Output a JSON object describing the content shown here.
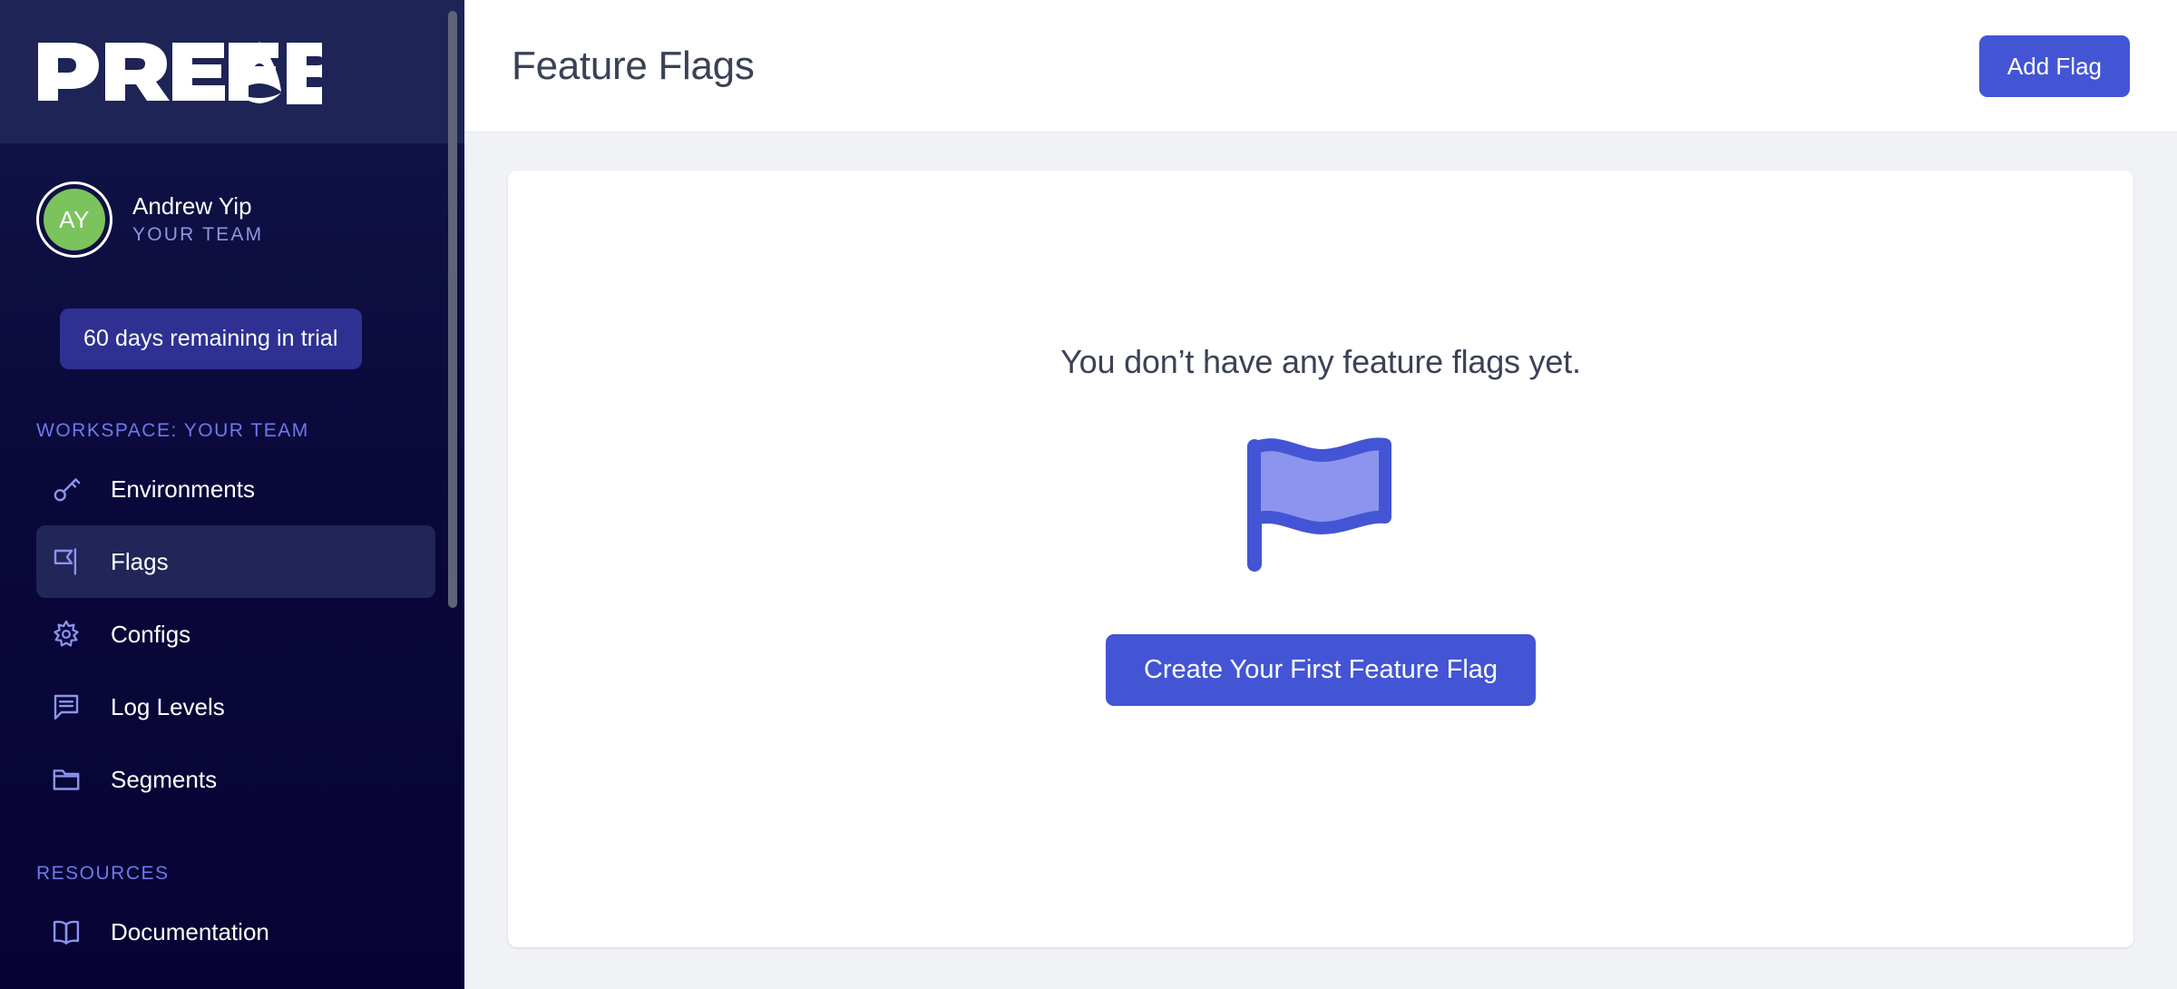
{
  "brand": {
    "name": "PREFAB",
    "logo_icon": "prefab-rocket-logo",
    "logo_color": "#ffffff",
    "sidebar_top_color": "#1e2456",
    "sidebar_bottom_color": "#070334"
  },
  "user": {
    "initials": "AY",
    "name": "Andrew Yip",
    "team": "YOUR TEAM",
    "avatar_color": "#7ac35d"
  },
  "trial": {
    "label": "60 days remaining in trial",
    "badge_color": "#2e3192"
  },
  "sidebar": {
    "sections": [
      {
        "label": "WORKSPACE: YOUR TEAM",
        "items": [
          {
            "label": "Environments",
            "icon": "key-icon",
            "active": false
          },
          {
            "label": "Flags",
            "icon": "flag-icon",
            "active": true
          },
          {
            "label": "Configs",
            "icon": "gear-icon",
            "active": false
          },
          {
            "label": "Log Levels",
            "icon": "message-lines-icon",
            "active": false
          },
          {
            "label": "Segments",
            "icon": "folder-icon",
            "active": false
          }
        ]
      },
      {
        "label": "RESOURCES",
        "items": [
          {
            "label": "Documentation",
            "icon": "book-icon",
            "active": false
          }
        ]
      }
    ],
    "section_label_color": "#6f79e8",
    "active_item_color": "#212558"
  },
  "header": {
    "title": "Feature Flags",
    "add_flag_label": "Add Flag",
    "accent_color": "#4355d4"
  },
  "main": {
    "empty_state": {
      "message": "You don’t have any feature flags yet.",
      "illustration_icon": "waving-flag-illustration",
      "illustration_stroke": "#4355d4",
      "illustration_fill": "#8b95ee",
      "cta_label": "Create Your First Feature Flag"
    },
    "background_color": "#f1f2f6",
    "card_color": "#ffffff"
  }
}
